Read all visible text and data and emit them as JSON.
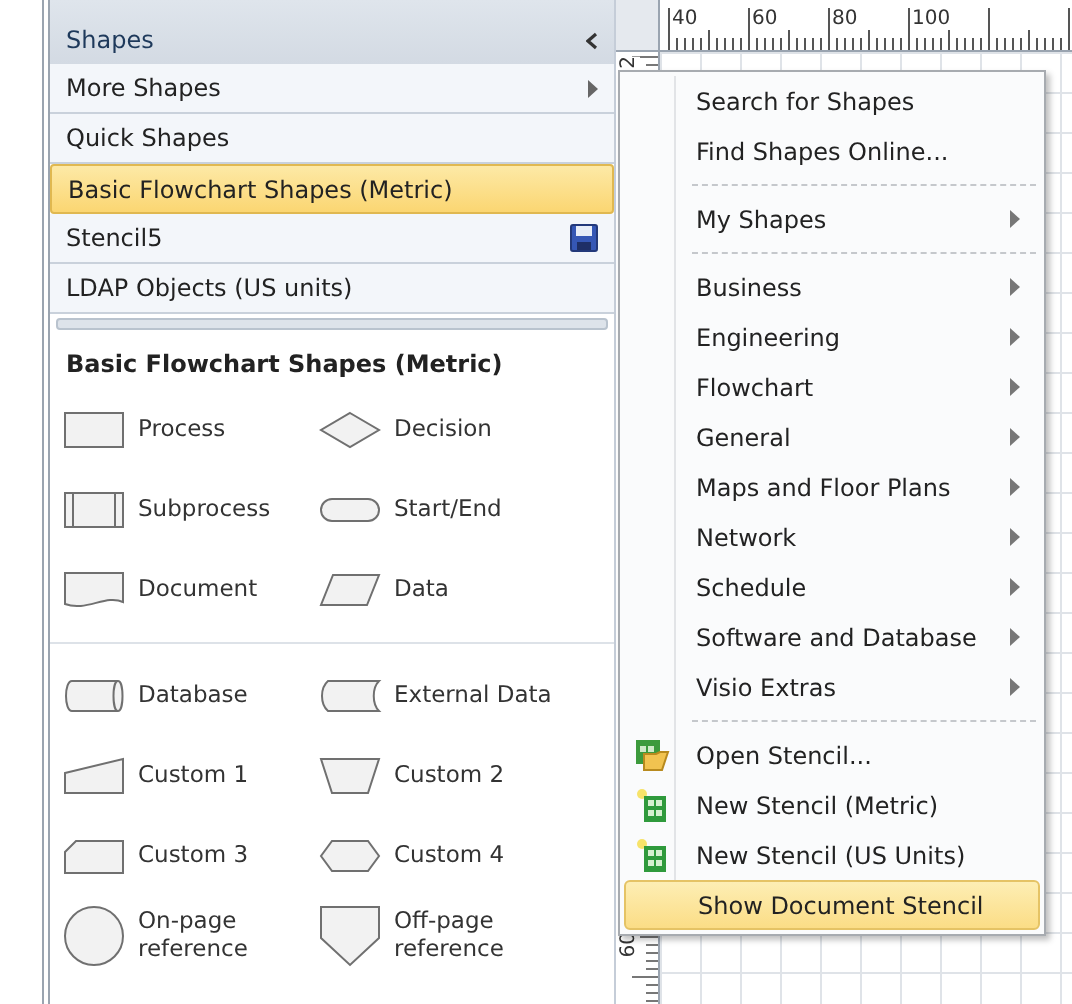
{
  "shapes_panel": {
    "title": "Shapes",
    "stencils": [
      {
        "label": "More Shapes",
        "submenu": true,
        "unsaved": false,
        "selected": false
      },
      {
        "label": "Quick Shapes",
        "submenu": false,
        "unsaved": false,
        "selected": false
      },
      {
        "label": "Basic Flowchart Shapes (Metric)",
        "submenu": false,
        "unsaved": false,
        "selected": true
      },
      {
        "label": "Stencil5",
        "submenu": false,
        "unsaved": true,
        "selected": false
      },
      {
        "label": "LDAP Objects (US units)",
        "submenu": false,
        "unsaved": false,
        "selected": false
      }
    ],
    "stencil_title": "Basic Flowchart Shapes (Metric)",
    "shape_groups": [
      [
        {
          "label": "Process",
          "kind": "process"
        },
        {
          "label": "Decision",
          "kind": "decision"
        },
        {
          "label": "Subprocess",
          "kind": "subprocess"
        },
        {
          "label": "Start/End",
          "kind": "terminator"
        },
        {
          "label": "Document",
          "kind": "document"
        },
        {
          "label": "Data",
          "kind": "data"
        }
      ],
      [
        {
          "label": "Database",
          "kind": "database"
        },
        {
          "label": "External Data",
          "kind": "external"
        },
        {
          "label": "Custom 1",
          "kind": "manual"
        },
        {
          "label": "Custom 2",
          "kind": "trapezoid"
        },
        {
          "label": "Custom 3",
          "kind": "card"
        },
        {
          "label": "Custom 4",
          "kind": "hexagon"
        },
        {
          "label": "On-page reference",
          "kind": "circle"
        },
        {
          "label": "Off-page reference",
          "kind": "offpage"
        }
      ]
    ]
  },
  "ruler": {
    "top_labels": [
      "40",
      "60",
      "80",
      "100"
    ],
    "left_labels": [
      "2",
      "60"
    ]
  },
  "menu": {
    "items": [
      {
        "kind": "plain",
        "label": "Search for Shapes",
        "submenu": false,
        "selected": false
      },
      {
        "kind": "plain",
        "label": "Find Shapes Online...",
        "submenu": false,
        "selected": false
      },
      {
        "kind": "separator"
      },
      {
        "kind": "plain",
        "label": "My Shapes",
        "submenu": true,
        "selected": false
      },
      {
        "kind": "separator"
      },
      {
        "kind": "plain",
        "label": "Business",
        "submenu": true,
        "selected": false
      },
      {
        "kind": "plain",
        "label": "Engineering",
        "submenu": true,
        "selected": false
      },
      {
        "kind": "plain",
        "label": "Flowchart",
        "submenu": true,
        "selected": false
      },
      {
        "kind": "plain",
        "label": "General",
        "submenu": true,
        "selected": false
      },
      {
        "kind": "plain",
        "label": "Maps and Floor Plans",
        "submenu": true,
        "selected": false
      },
      {
        "kind": "plain",
        "label": "Network",
        "submenu": true,
        "selected": false
      },
      {
        "kind": "plain",
        "label": "Schedule",
        "submenu": true,
        "selected": false
      },
      {
        "kind": "plain",
        "label": "Software and Database",
        "submenu": true,
        "selected": false
      },
      {
        "kind": "plain",
        "label": "Visio Extras",
        "submenu": true,
        "selected": false
      },
      {
        "kind": "separator"
      },
      {
        "kind": "open",
        "label": "Open Stencil...",
        "submenu": false,
        "selected": false
      },
      {
        "kind": "new",
        "label": "New Stencil (Metric)",
        "submenu": false,
        "selected": false
      },
      {
        "kind": "new",
        "label": "New Stencil (US Units)",
        "submenu": false,
        "selected": false
      },
      {
        "kind": "plain",
        "label": "Show Document Stencil",
        "submenu": false,
        "selected": true
      }
    ]
  }
}
